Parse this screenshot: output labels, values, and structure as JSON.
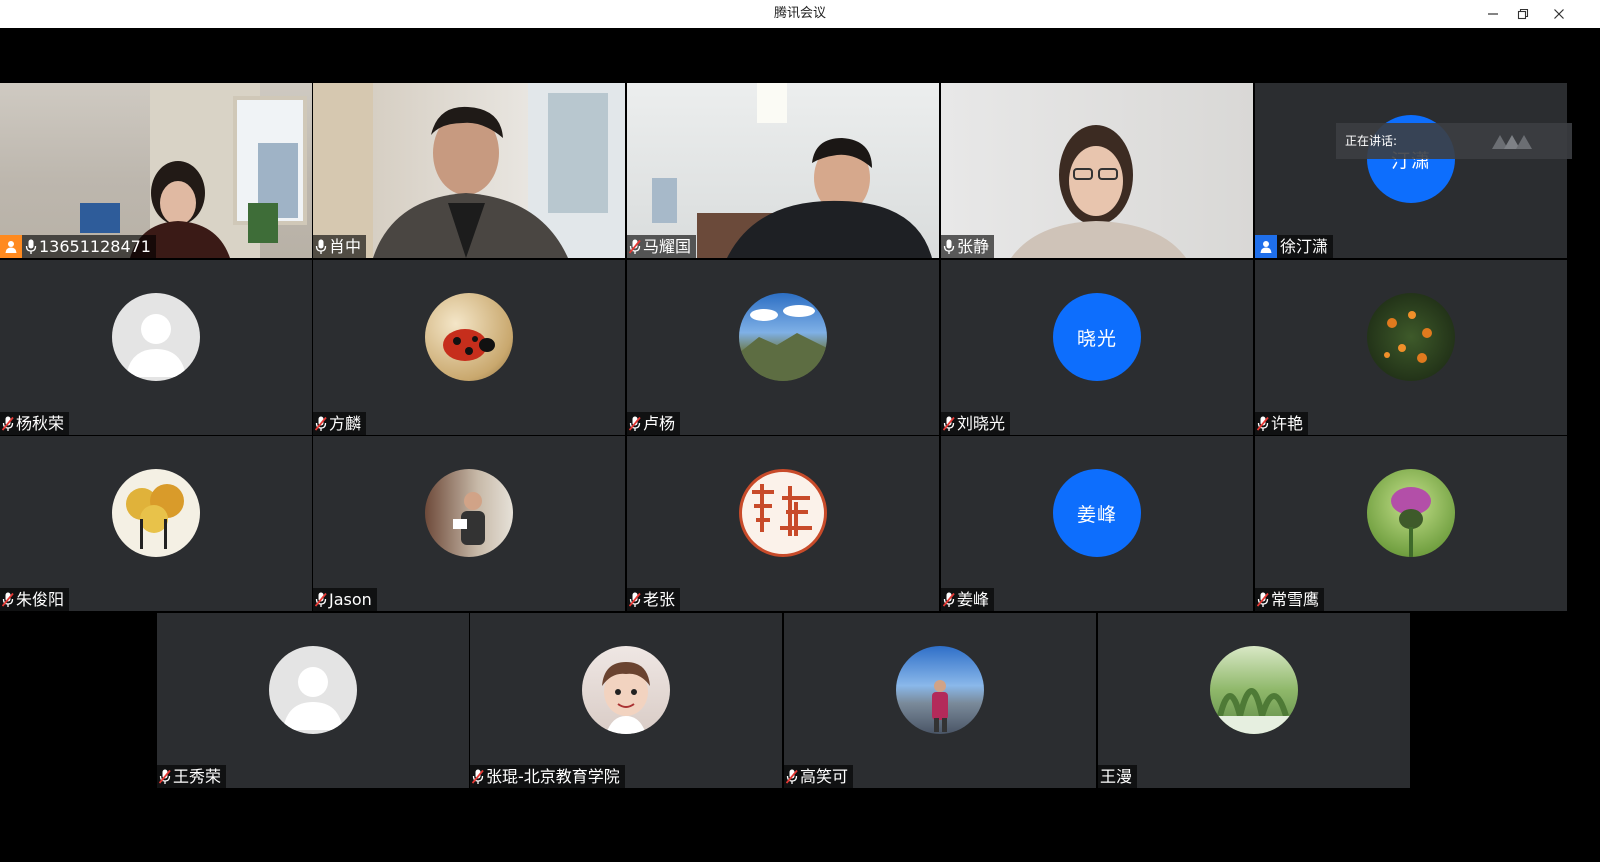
{
  "window": {
    "title": "腾讯会议"
  },
  "speaking": {
    "label": "正在讲话:"
  },
  "participants": [
    {
      "name": "13651128471",
      "type": "video",
      "role": "host",
      "mic": "on"
    },
    {
      "name": "肖中",
      "type": "video",
      "mic": "on"
    },
    {
      "name": "马耀国",
      "type": "video",
      "mic": "muted"
    },
    {
      "name": "张静",
      "type": "video",
      "mic": "on"
    },
    {
      "name": "徐汀潇",
      "type": "initials",
      "initials": "汀潇",
      "role": "cohost",
      "mic": "none"
    },
    {
      "name": "杨秋荣",
      "type": "default-avatar",
      "mic": "muted"
    },
    {
      "name": "方麟",
      "type": "photo",
      "photo": "ladybug-photo",
      "mic": "muted"
    },
    {
      "name": "卢杨",
      "type": "photo",
      "photo": "mountain-sky-photo",
      "mic": "muted"
    },
    {
      "name": "刘晓光",
      "type": "initials",
      "initials": "晓光",
      "mic": "muted"
    },
    {
      "name": "许艳",
      "type": "photo",
      "photo": "flowers-photo",
      "mic": "muted"
    },
    {
      "name": "朱俊阳",
      "type": "photo",
      "photo": "autumn-tree-painting",
      "mic": "muted"
    },
    {
      "name": "Jason",
      "type": "photo",
      "photo": "speaker-photo",
      "mic": "muted"
    },
    {
      "name": "老张",
      "type": "photo",
      "photo": "red-seal-stamp",
      "mic": "muted"
    },
    {
      "name": "姜峰",
      "type": "initials",
      "initials": "姜峰",
      "mic": "muted"
    },
    {
      "name": "常雪鹰",
      "type": "photo",
      "photo": "thistle-photo",
      "mic": "muted"
    },
    {
      "name": "王秀荣",
      "type": "default-avatar",
      "mic": "muted"
    },
    {
      "name": "张琨-北京教育学院",
      "type": "photo",
      "photo": "child-photo",
      "mic": "muted"
    },
    {
      "name": "高笑可",
      "type": "photo",
      "photo": "lakeside-photo",
      "mic": "muted"
    },
    {
      "name": "王漫",
      "type": "photo",
      "photo": "green-landscape-photo",
      "mic": "none"
    }
  ],
  "colors": {
    "tile_bg": "#2b2d30",
    "initials_avatar": "#0d6efd",
    "host_badge": "#ff8a1f",
    "cohost_badge": "#1f6feb"
  }
}
